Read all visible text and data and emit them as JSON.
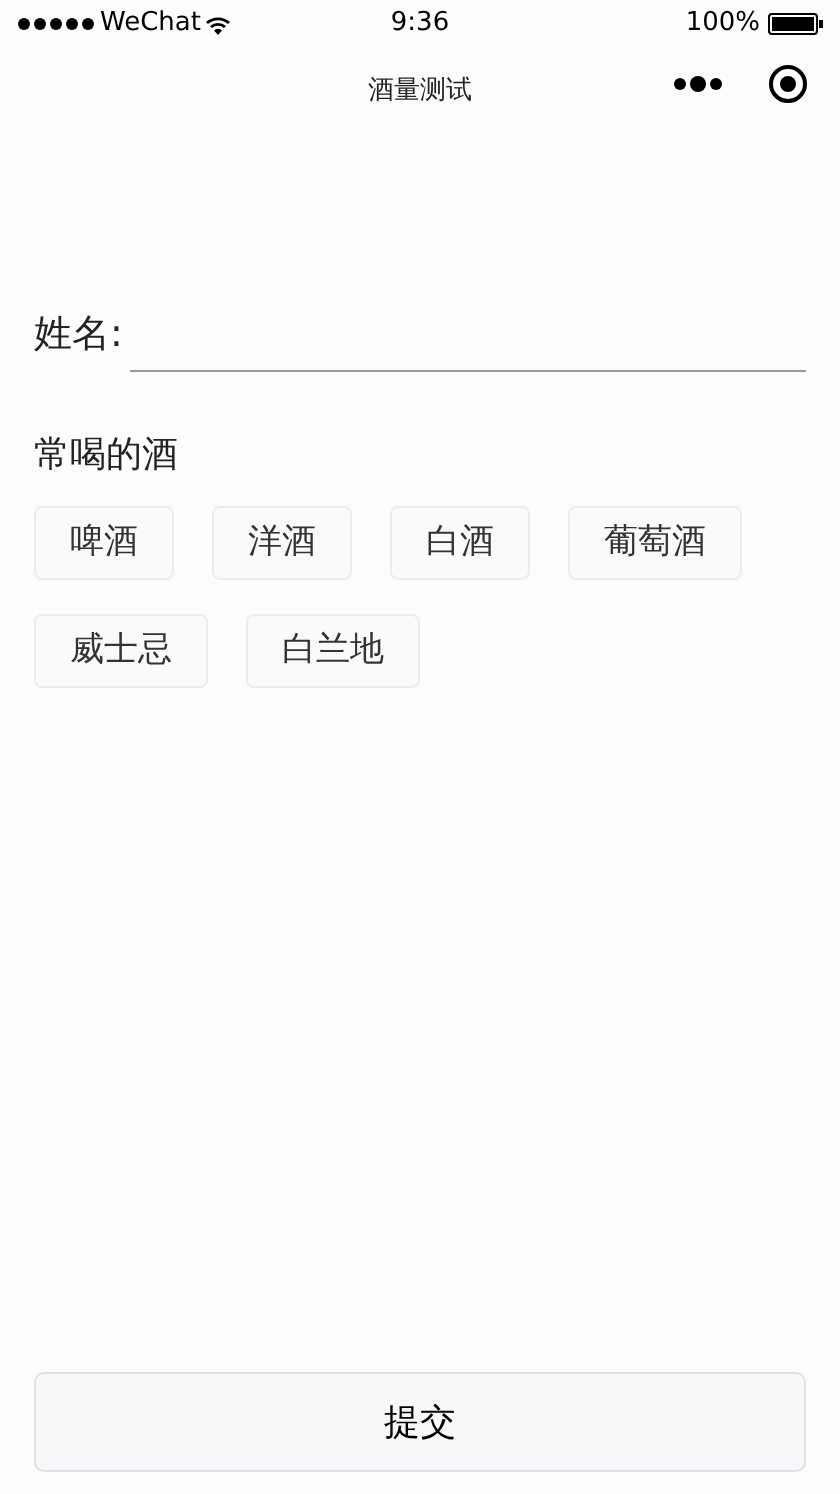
{
  "status_bar": {
    "carrier": "WeChat",
    "time": "9:36",
    "battery": "100%"
  },
  "nav": {
    "title": "酒量测试"
  },
  "name_field": {
    "label": "姓名:"
  },
  "drinks": {
    "label": "常喝的酒",
    "options": [
      {
        "label": "啤酒",
        "selected": false
      },
      {
        "label": "洋酒",
        "selected": false
      },
      {
        "label": "白酒",
        "selected": false
      },
      {
        "label": "葡萄酒",
        "selected": false
      },
      {
        "label": "威士忌",
        "selected": false
      },
      {
        "label": "白兰地",
        "selected": false
      }
    ]
  },
  "submit": {
    "label": "提交"
  }
}
